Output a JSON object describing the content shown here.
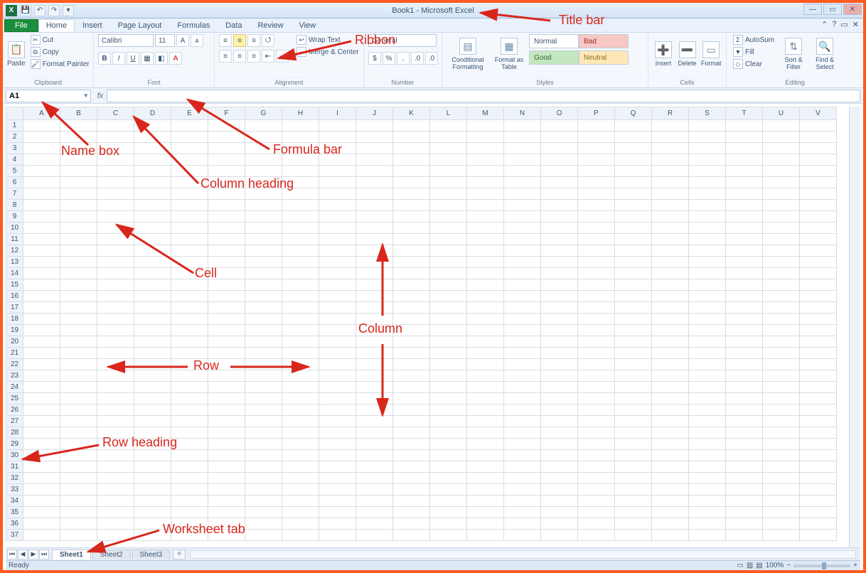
{
  "title": "Book1 - Microsoft Excel",
  "qat": {
    "save": "💾",
    "undo": "↶",
    "redo": "↷"
  },
  "tabs": {
    "file": "File",
    "items": [
      "Home",
      "Insert",
      "Page Layout",
      "Formulas",
      "Data",
      "Review",
      "View"
    ],
    "active": "Home"
  },
  "ribbon": {
    "clipboard": {
      "label": "Clipboard",
      "paste": "Paste",
      "cut": "Cut",
      "copy": "Copy",
      "format_painter": "Format Painter"
    },
    "font": {
      "label": "Font",
      "name": "Calibri",
      "size": "11",
      "increase": "A▲",
      "decrease": "A▼",
      "bold": "B",
      "italic": "I",
      "underline": "U"
    },
    "alignment": {
      "label": "Alignment",
      "wrap": "Wrap Text",
      "merge": "Merge & Center"
    },
    "number": {
      "label": "Number",
      "format": "General"
    },
    "styles": {
      "label": "Styles",
      "conditional": "Conditional Formatting",
      "format_table": "Format as Table",
      "normal": "Normal",
      "bad": "Bad",
      "good": "Good",
      "neutral": "Neutral"
    },
    "cells": {
      "label": "Cells",
      "insert": "Insert",
      "delete": "Delete",
      "format": "Format"
    },
    "editing": {
      "label": "Editing",
      "autosum": "AutoSum",
      "fill": "Fill",
      "clear": "Clear",
      "sort": "Sort & Filter",
      "find": "Find & Select"
    }
  },
  "namebox": "A1",
  "fx": "fx",
  "columns": [
    "A",
    "B",
    "C",
    "D",
    "E",
    "F",
    "G",
    "H",
    "I",
    "J",
    "K",
    "L",
    "M",
    "N",
    "O",
    "P",
    "Q",
    "R",
    "S",
    "T",
    "U",
    "V"
  ],
  "rows": [
    1,
    2,
    3,
    4,
    5,
    6,
    7,
    8,
    9,
    10,
    11,
    12,
    13,
    14,
    15,
    16,
    17,
    18,
    19,
    20,
    21,
    22,
    23,
    24,
    25,
    26,
    27,
    28,
    29,
    30,
    31,
    32,
    33,
    34,
    35,
    36,
    37
  ],
  "sheets": {
    "active": "Sheet1",
    "tabs": [
      "Sheet1",
      "Sheet2",
      "Sheet3"
    ]
  },
  "status": {
    "ready": "Ready",
    "zoom": "100%"
  },
  "annotations": {
    "titlebar": "Title bar",
    "ribbon": "Ribbon",
    "namebox": "Name box",
    "formulabar": "Formula bar",
    "colheading": "Column heading",
    "cell": "Cell",
    "column": "Column",
    "row": "Row",
    "rowheading": "Row heading",
    "worksheettab": "Worksheet tab"
  }
}
